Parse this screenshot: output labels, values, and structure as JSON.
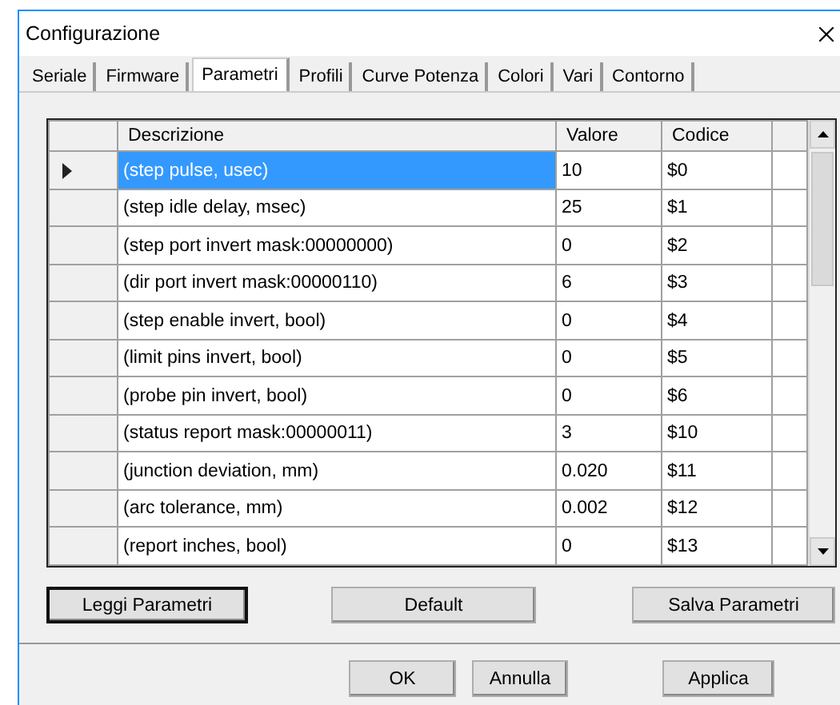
{
  "window": {
    "title": "Configurazione"
  },
  "tabs": [
    {
      "label": "Seriale",
      "selected": false
    },
    {
      "label": "Firmware",
      "selected": false
    },
    {
      "label": "Parametri",
      "selected": true
    },
    {
      "label": "Profili",
      "selected": false
    },
    {
      "label": "Curve Potenza",
      "selected": false
    },
    {
      "label": "Colori",
      "selected": false
    },
    {
      "label": "Vari",
      "selected": false
    },
    {
      "label": "Contorno",
      "selected": false
    }
  ],
  "table": {
    "columns": [
      "Descrizione",
      "Valore",
      "Codice"
    ],
    "rows": [
      {
        "description": "(step pulse, usec)",
        "value": "10",
        "code": "$0",
        "selected": true
      },
      {
        "description": "(step idle delay, msec)",
        "value": "25",
        "code": "$1",
        "selected": false
      },
      {
        "description": "(step port invert mask:00000000)",
        "value": "0",
        "code": "$2",
        "selected": false
      },
      {
        "description": "(dir port invert mask:00000110)",
        "value": "6",
        "code": "$3",
        "selected": false
      },
      {
        "description": "(step enable invert, bool)",
        "value": "0",
        "code": "$4",
        "selected": false
      },
      {
        "description": "(limit pins invert, bool)",
        "value": "0",
        "code": "$5",
        "selected": false
      },
      {
        "description": "(probe pin invert, bool)",
        "value": "0",
        "code": "$6",
        "selected": false
      },
      {
        "description": "(status report mask:00000011)",
        "value": "3",
        "code": "$10",
        "selected": false
      },
      {
        "description": "(junction deviation, mm)",
        "value": "0.020",
        "code": "$11",
        "selected": false
      },
      {
        "description": "(arc tolerance, mm)",
        "value": "0.002",
        "code": "$12",
        "selected": false
      },
      {
        "description": "(report inches, bool)",
        "value": "0",
        "code": "$13",
        "selected": false
      }
    ]
  },
  "panel_buttons": [
    {
      "label": "Leggi Parametri",
      "focused": true
    },
    {
      "label": "Default",
      "focused": false
    },
    {
      "label": "Salva Parametri",
      "focused": false
    }
  ],
  "dialog_buttons": [
    {
      "label": "OK",
      "focused": false
    },
    {
      "label": "Annulla",
      "focused": false
    },
    {
      "label": "Applica",
      "focused": false
    }
  ]
}
